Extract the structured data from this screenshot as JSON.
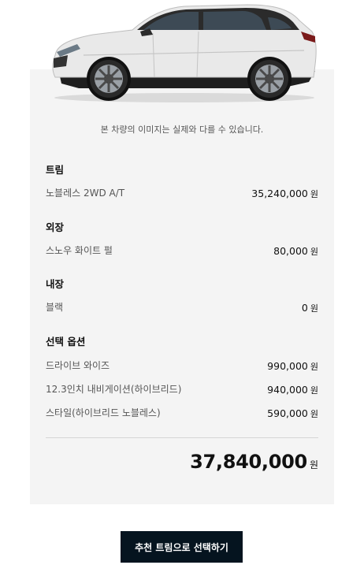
{
  "notice": "본 차량의 이미지는 실제와 다를 수 있습니다.",
  "currency": "원",
  "sections": {
    "trim": {
      "title": "트림",
      "items": [
        {
          "label": "노블레스 2WD A/T",
          "price": "35,240,000"
        }
      ]
    },
    "exterior": {
      "title": "외장",
      "items": [
        {
          "label": "스노우 화이트 펄",
          "price": "80,000"
        }
      ]
    },
    "interior": {
      "title": "내장",
      "items": [
        {
          "label": "블랙",
          "price": "0"
        }
      ]
    },
    "options": {
      "title": "선택 옵션",
      "items": [
        {
          "label": "드라이브 와이즈",
          "price": "990,000"
        },
        {
          "label": "12.3인치 내비게이션(하이브리드)",
          "price": "940,000"
        },
        {
          "label": "스타일(하이브리드 노블레스)",
          "price": "590,000"
        }
      ]
    }
  },
  "total": "37,840,000",
  "cta_label": "추천 트림으로 선택하기",
  "colors": {
    "panel_bg": "#f4f4f4",
    "cta_bg": "#05141f",
    "car_body": "#e8e8e8"
  }
}
